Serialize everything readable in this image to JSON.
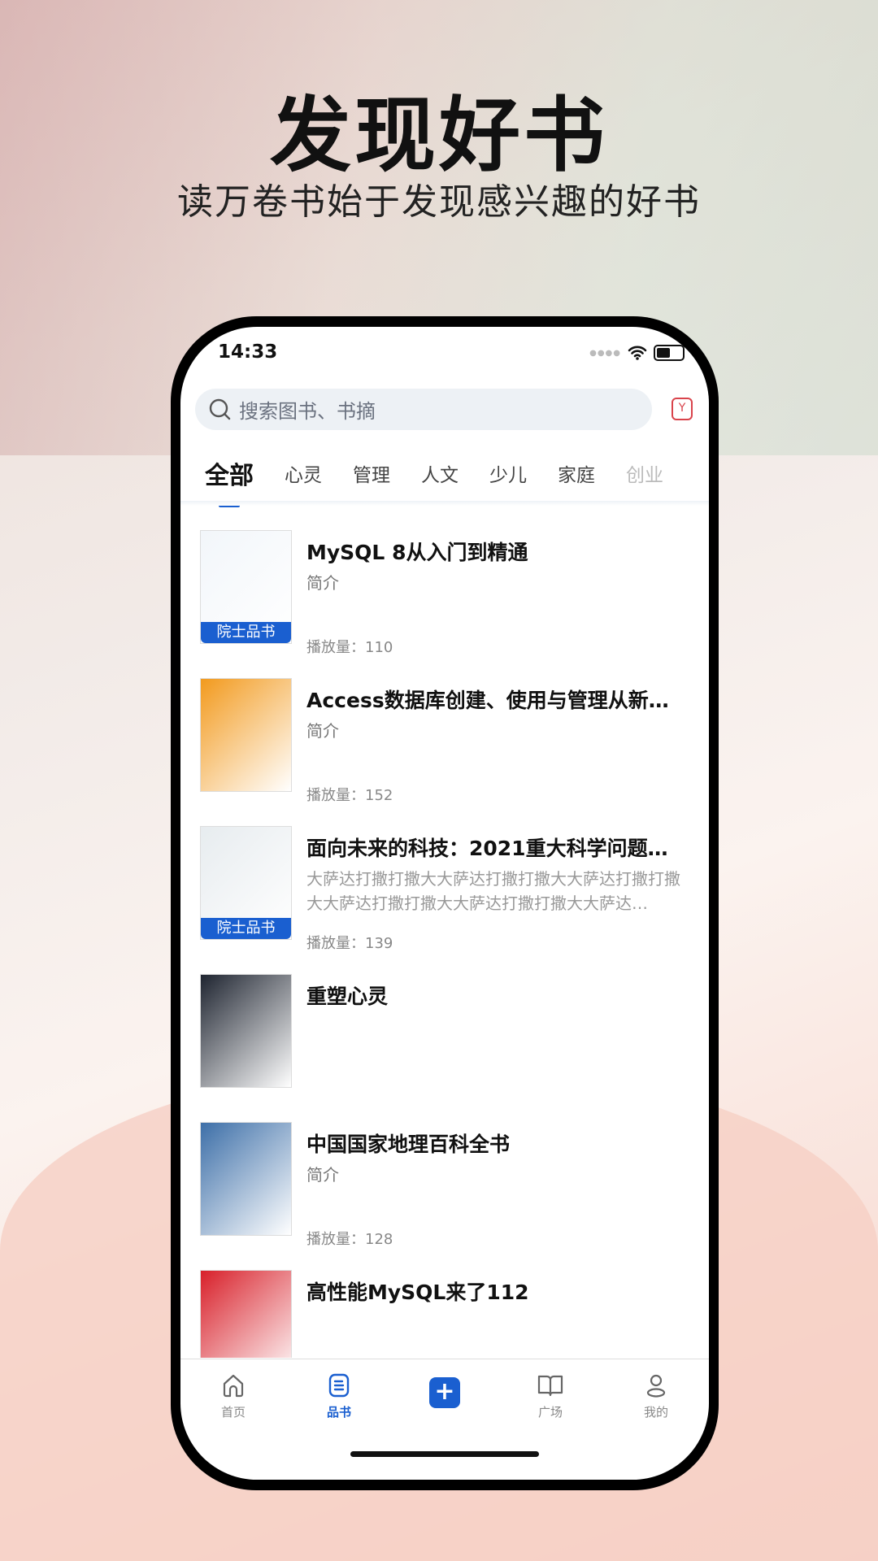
{
  "hero": {
    "title": "发现好书",
    "subtitle": "读万卷书始于发现感兴趣的好书"
  },
  "status": {
    "time": "14:33"
  },
  "search": {
    "placeholder": "搜索图书、书摘"
  },
  "tabs": [
    {
      "label": "全部",
      "active": true
    },
    {
      "label": "心灵"
    },
    {
      "label": "管理"
    },
    {
      "label": "人文"
    },
    {
      "label": "少儿"
    },
    {
      "label": "家庭"
    },
    {
      "label": "创业"
    }
  ],
  "books": [
    {
      "title": "MySQL 8从入门到精通",
      "summary": "简介",
      "plays": "播放量：110",
      "badge": "院士品书",
      "cover_color": "#f2f6fa"
    },
    {
      "title": "Access数据库创建、使用与管理从新…",
      "summary": "简介",
      "plays": "播放量：152",
      "badge": "",
      "cover_color": "#f29a1e"
    },
    {
      "title": "面向未来的科技：2021重大科学问题…",
      "summary": "大萨达打撒打撒大大萨达打撒打撒大大萨达打撒打撒大大萨达打撒打撒大大萨达打撒打撒大大萨达…",
      "plays": "播放量：139",
      "badge": "院士品书",
      "cover_color": "#e7ecef"
    },
    {
      "title": "重塑心灵",
      "summary": "",
      "plays": "",
      "badge": "",
      "cover_color": "#1e2430"
    },
    {
      "title": "中国国家地理百科全书",
      "summary": "简介",
      "plays": "播放量：128",
      "badge": "",
      "cover_color": "#3d6fa8"
    },
    {
      "title": "高性能MySQL来了112",
      "summary": "",
      "plays": "",
      "badge": "",
      "cover_color": "#d8202a"
    }
  ],
  "nav": [
    {
      "label": "首页",
      "icon": "home-icon"
    },
    {
      "label": "品书",
      "icon": "document-icon",
      "active": true
    },
    {
      "label": "",
      "icon": "plus-icon"
    },
    {
      "label": "广场",
      "icon": "book-open-icon"
    },
    {
      "label": "我的",
      "icon": "user-icon"
    }
  ],
  "colors": {
    "accent": "#1a5fd0",
    "gift": "#d9434b"
  }
}
